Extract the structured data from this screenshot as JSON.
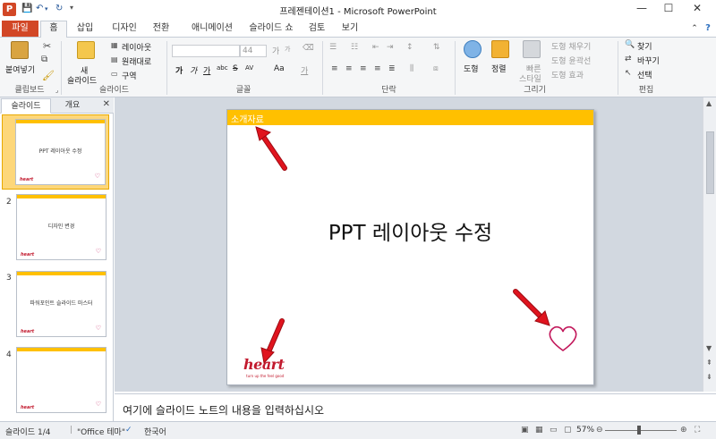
{
  "window": {
    "title": "프레젠테이션1 - Microsoft PowerPoint",
    "app_icon": "P",
    "minimize": "—",
    "maximize": "☐",
    "close": "✕"
  },
  "ribbon_tabs": {
    "file": "파일",
    "items": [
      "홈",
      "삽입",
      "디자인",
      "전환",
      "애니메이션",
      "슬라이드 쇼",
      "검토",
      "보기"
    ]
  },
  "ribbon": {
    "clipboard": {
      "paste": "붙여넣기",
      "label": "클립보드"
    },
    "slides": {
      "new_slide_1": "새",
      "new_slide_2": "슬라이드",
      "layout": "레이아웃",
      "reset": "원래대로",
      "section": "구역",
      "label": "슬라이드"
    },
    "font": {
      "size": "44",
      "label": "글꼴",
      "grow": "가",
      "shrink": "가",
      "case": "Aa",
      "bold": "가",
      "italic": "가",
      "underline": "가",
      "strike": "S",
      "shadow": "abc",
      "spacing": "AV"
    },
    "paragraph": {
      "label": "단락"
    },
    "drawing": {
      "shape": "도형",
      "arrange": "정렬",
      "quick_styles_1": "빠른",
      "quick_styles_2": "스타일",
      "fill": "도형 채우기",
      "outline": "도형 윤곽선",
      "effects": "도형 효과",
      "label": "그리기"
    },
    "editing": {
      "find": "찾기",
      "replace": "바꾸기",
      "select": "선택",
      "label": "편집"
    }
  },
  "left_panel": {
    "tab_slides": "슬라이드",
    "tab_outline": "개요",
    "close": "✕",
    "thumbnails": [
      {
        "num": "1",
        "text": "PPT 레이아웃 수정",
        "selected": true
      },
      {
        "num": "2",
        "text": "디자인 변경",
        "selected": false
      },
      {
        "num": "3",
        "text": "파워포인트 슬라이드 마스터",
        "selected": false
      },
      {
        "num": "4",
        "text": "",
        "selected": false
      }
    ],
    "thumb_logo": "heart"
  },
  "slide": {
    "header_text": "소개자료",
    "title": "PPT 레이아웃 수정",
    "logo": "heart",
    "logo_tagline": "turn up the feel good",
    "accent_color": "#ffc000",
    "arrow_color": "#e0141e"
  },
  "notes": {
    "placeholder": "여기에 슬라이드 노트의 내용을 입력하십시오"
  },
  "status": {
    "slide_info": "슬라이드 1/4",
    "theme": "\"Office 테마\"",
    "language": "한국어",
    "zoom": "57%"
  }
}
